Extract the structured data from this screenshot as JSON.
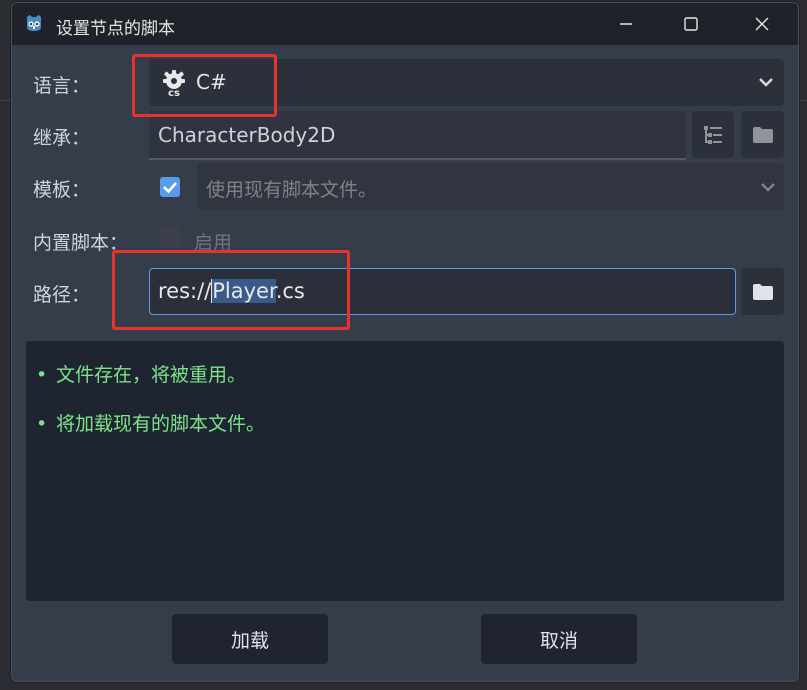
{
  "window": {
    "title": "设置节点的脚本",
    "controls": [
      "minimize",
      "maximize",
      "close"
    ]
  },
  "form": {
    "language": {
      "label": "语言：",
      "value": "C#",
      "icon": "csharp-gear-icon"
    },
    "inherits": {
      "label": "继承：",
      "value": "CharacterBody2D"
    },
    "template": {
      "label": "模板：",
      "checked": true,
      "value": "使用现有脚本文件。"
    },
    "builtin": {
      "label": "内置脚本：",
      "checked": false,
      "option_label": "启用"
    },
    "path": {
      "label": "路径：",
      "value_prefix": "res://",
      "value_selected": "Player",
      "value_suffix": ".cs"
    }
  },
  "messages": [
    {
      "bullet": "•",
      "text": "文件存在，将被重用。"
    },
    {
      "bullet": "•",
      "text": "将加载现有的脚本文件。"
    }
  ],
  "buttons": {
    "load": "加载",
    "cancel": "取消"
  },
  "colors": {
    "accent": "#5a9bea",
    "message_green": "#7ce38b",
    "highlight_annotation": "#e8332d",
    "selection_bg": "#3a5a8a"
  }
}
